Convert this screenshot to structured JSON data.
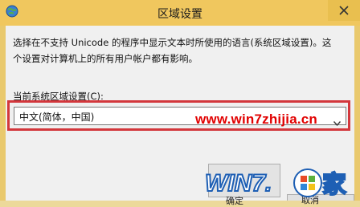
{
  "window": {
    "title": "区域设置",
    "description_lines": [
      "选择在不支持 Unicode 的程序中显示文本时所使用的语言(系统区域设置)。这",
      "个设置对计算机上的所有用户帐户都有影响。"
    ],
    "current_locale_label": "当前系统区域设置(C):",
    "current_locale_value": "中文(简体，中国)",
    "ok_label": "确定",
    "cancel_label": "取消"
  },
  "watermark": {
    "url": "www.win7zhijia.cn",
    "logo_text": "WIN7.",
    "logo_suffix": "家"
  },
  "colors": {
    "frame": "#e9c96d",
    "highlight_border": "#d3373c",
    "watermark_red": "#e10000",
    "logo_blue": "#1e5fb4"
  }
}
